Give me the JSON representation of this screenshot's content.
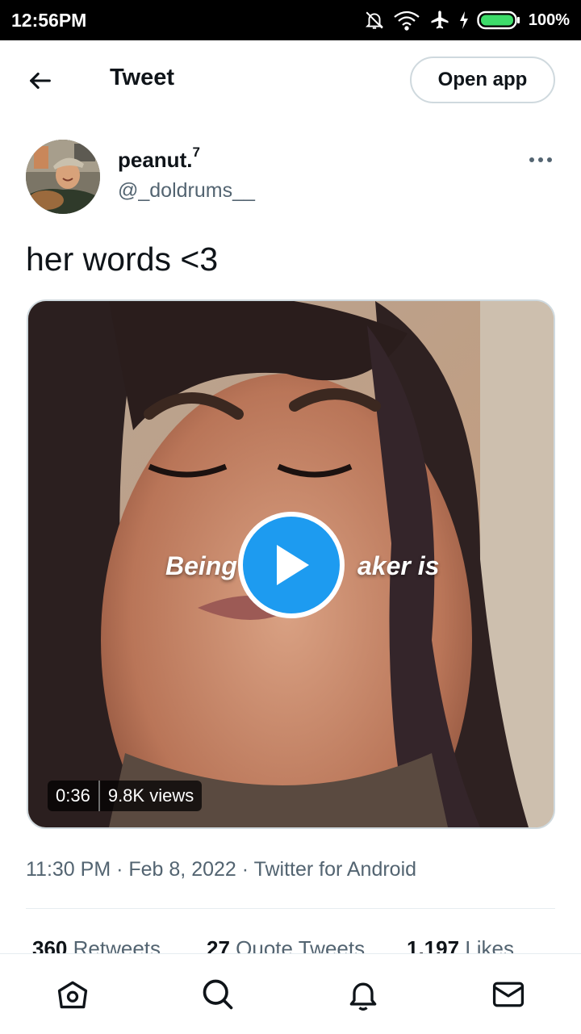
{
  "status_bar": {
    "time": "12:56PM",
    "battery": "100%"
  },
  "header": {
    "title": "Tweet",
    "open_app_label": "Open app"
  },
  "tweet": {
    "display_name": "peanut.",
    "name_superscript": "7",
    "handle": "@_doldrums__",
    "text": "her words <3",
    "video": {
      "caption_left": "Being",
      "caption_right": "aker is",
      "duration": "0:36",
      "views": "9.8K views"
    },
    "timestamp": "11:30 PM · Feb 8, 2022 · Twitter for Android"
  },
  "stats": {
    "retweets_count": "360",
    "retweets_label": "Retweets",
    "quotes_count": "27",
    "quotes_label": "Quote Tweets",
    "likes_count": "1,197",
    "likes_label": "Likes"
  },
  "icons": {
    "back": "arrow-left-icon",
    "more": "more-horizontal-icon",
    "play": "play-icon",
    "nav": [
      "home-icon",
      "search-icon",
      "notifications-icon",
      "messages-icon"
    ]
  },
  "colors": {
    "accent": "#1d9bf0",
    "text": "#0f1419",
    "muted": "#536471",
    "border": "#cfd9de"
  }
}
